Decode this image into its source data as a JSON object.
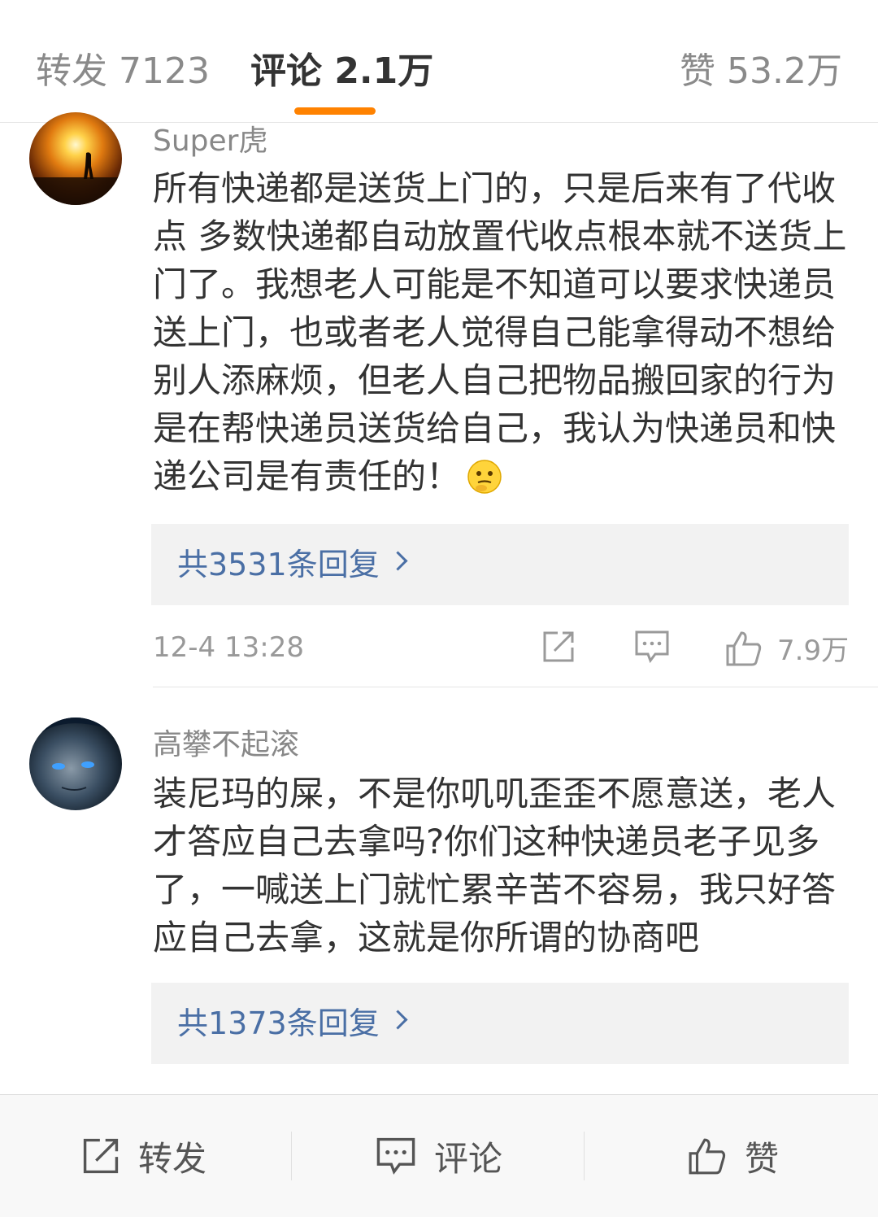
{
  "tabs": {
    "repost": "转发 7123",
    "comment": "评论 2.1万",
    "like": "赞 53.2万",
    "accent_color": "#ff8200"
  },
  "comments": [
    {
      "username": "Super虎",
      "text": "所有快递都是送货上门的，只是后来有了代收点 多数快递都自动放置代收点根本就不送货上门了。我想老人可能是不知道可以要求快递员送上门，也或者老人觉得自己能拿得动不想给别人添麻烦，但老人自己把物品搬回家的行为是在帮快递员送货给自己，我认为快递员和快递公司是有责任的！",
      "emoji": "thinking-emoji",
      "replies": "共3531条回复",
      "time": "12-4 13:28",
      "likes": "7.9万"
    },
    {
      "username": "高攀不起滚",
      "text": "装尼玛的屎，不是你叽叽歪歪不愿意送，老人才答应自己去拿吗?你们这种快递员老子见多了，一喊送上门就忙累辛苦不容易，我只好答应自己去拿，这就是你所谓的协商吧",
      "replies": "共1373条回复"
    }
  ],
  "bottom_bar": {
    "repost": "转发",
    "comment": "评论",
    "like": "赞"
  }
}
